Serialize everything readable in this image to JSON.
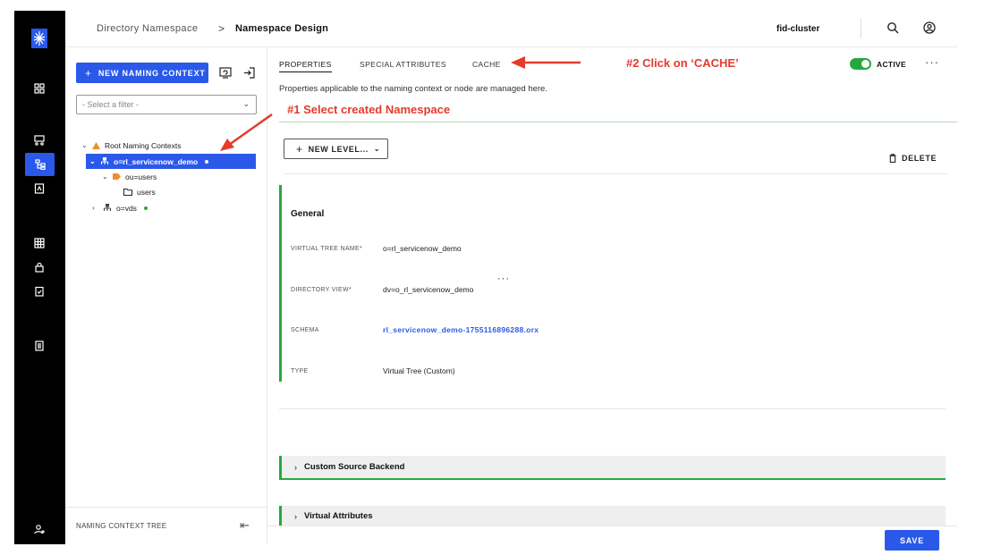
{
  "topbar": {
    "breadcrumb_root": "Directory Namespace",
    "breadcrumb_sep": ">",
    "breadcrumb_current": "Namespace Design",
    "cluster": "fid-cluster"
  },
  "left_panel": {
    "new_button_plus": "+",
    "new_button_label": "NEW NAMING CONTEXT",
    "filter_placeholder": "- Select a filter -",
    "footer_label": "NAMING CONTEXT TREE",
    "tree": {
      "root": "Root Naming Contexts",
      "node_selected": "o=rl_servicenow_demo",
      "node_child": "ou=users",
      "node_leaf": "users",
      "node_other": "o=vds"
    }
  },
  "main": {
    "tabs": [
      "PROPERTIES",
      "SPECIAL ATTRIBUTES",
      "CACHE"
    ],
    "active_label": "ACTIVE",
    "more": "···",
    "description": "Properties applicable to the naming context or node are managed here.",
    "new_level_plus": "+",
    "new_level_label": "NEW LEVEL...",
    "delete_label": "DELETE",
    "general_title": "General",
    "fields": {
      "virtual_tree_name_label": "VIRTUAL TREE NAME",
      "virtual_tree_name_value": "o=rl_servicenow_demo",
      "directory_view_label": "DIRECTORY VIEW",
      "directory_view_value": "dv=o_rl_servicenow_demo",
      "directory_view_more": "···",
      "schema_label": "SCHEMA",
      "schema_value": "rl_servicenow_demo-1755116896288.orx",
      "type_label": "TYPE",
      "type_value": "Virtual Tree (Custom)"
    },
    "required_mark": "*",
    "accordion_1": "Custom Source Backend",
    "accordion_2": "Virtual Attributes",
    "save_label": "SAVE"
  },
  "annotations": {
    "step1": "#1 Select created Namespace",
    "step2": "#2 Click on ‘CACHE’"
  },
  "colors": {
    "primary": "#2a59ea",
    "success": "#27a83e",
    "annotation": "#e53a2c",
    "rail": "#000000"
  },
  "icons": [
    "logo-icon",
    "dashboard-icon",
    "pipeline-icon",
    "namespace-icon",
    "control-panel-icon",
    "grid-icon",
    "lock-icon",
    "clipboard-check-icon",
    "list-icon",
    "user-settings-icon",
    "search-icon",
    "user-icon",
    "export-icon",
    "import-icon",
    "folder-icon",
    "tree-icon",
    "delete-icon"
  ]
}
